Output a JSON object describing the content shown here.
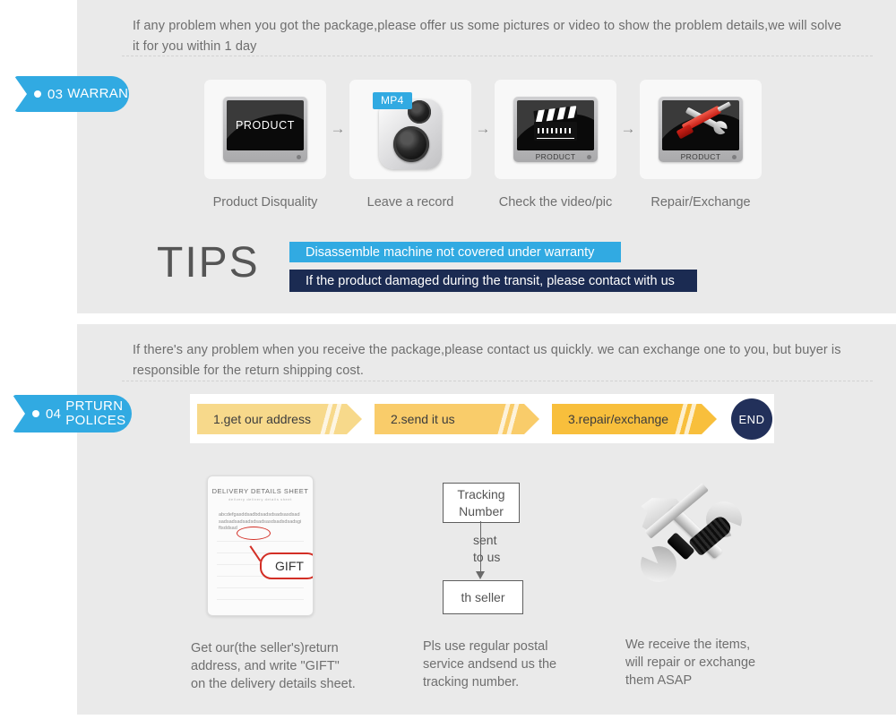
{
  "warranty_section": {
    "tag": {
      "number": "03",
      "label": "WARRANTY"
    },
    "intro": "If any problem when you got the package,please offer us some pictures or video to show the problem details,we will solve\n it for you within 1 day",
    "steps": [
      {
        "label": "Product Disquality",
        "icon": "monitor-product-icon",
        "screen_text": "PRODUCT"
      },
      {
        "label": "Leave a record",
        "icon": "camera-icon",
        "badge": "MP4"
      },
      {
        "label": "Check the video/pic",
        "icon": "clapperboard-monitor-icon",
        "base_text": "PRODUCT"
      },
      {
        "label": "Repair/Exchange",
        "icon": "tools-monitor-icon",
        "base_text": "PRODUCT"
      }
    ],
    "step_arrow": "→",
    "tips": {
      "heading": "TIPS",
      "bars": [
        {
          "text": "Disassemble machine not covered under warranty",
          "color": "#31aae2"
        },
        {
          "text": "If the product damaged during the transit, please contact with us",
          "color": "#1b2b52"
        }
      ]
    }
  },
  "returns_section": {
    "tag": {
      "number": "04",
      "label": "PRTURN\nPOLICES"
    },
    "intro": "If  there's any problem when you receive the package,please contact us quickly. we can exchange one to you, but buyer is\nresponsible for the return shipping cost.",
    "flow": {
      "chevrons": [
        {
          "text": "1.get our address",
          "color": "#f7d98b"
        },
        {
          "text": "2.send it us",
          "color": "#f9cc6a"
        },
        {
          "text": "3.repair/exchange",
          "color": "#f8bf3c"
        }
      ],
      "end_label": "END",
      "end_color": "#22305a"
    },
    "illustrations": {
      "sheet": {
        "title": "DELIVERY DETAILS SHEET",
        "subtitle": "delivery            delivery details sheet",
        "scribble": "abcdefgasddsadbdsadsdsadsasdsadsadsadsadsadsdsadsasdsadsdsadsgiftsddsad",
        "callout": "GIFT"
      },
      "tracking": {
        "box_top": "Tracking\nNumber",
        "middle": "sent\nto us",
        "box_bottom": "th seller"
      },
      "tools": {
        "icon": "hammer-wrench-screwdriver-icon"
      }
    },
    "captions": [
      "Get our(the seller's)return\naddress, and write \"GIFT\"\non the delivery details sheet.",
      "Pls use regular postal\nservice andsend us the\n tracking number.",
      "We receive the items,\nwill repair or exchange\n them ASAP"
    ]
  },
  "theme": {
    "panel_bg": "#eaeaea",
    "accent_blue": "#31aae2",
    "navy": "#1b2b52",
    "text_grey": "#6f6f6f"
  }
}
